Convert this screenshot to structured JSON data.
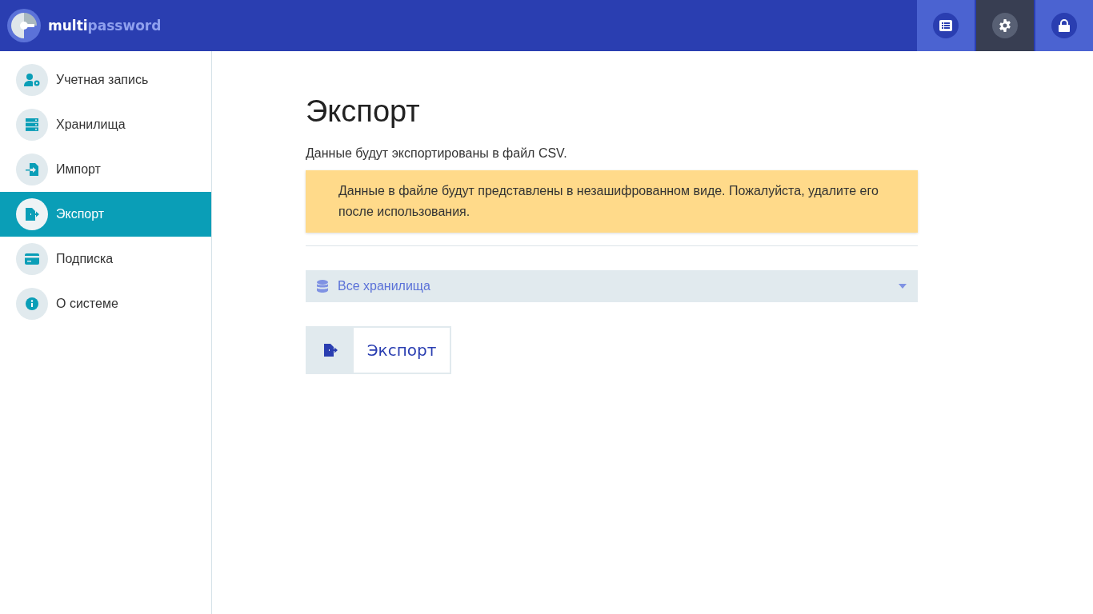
{
  "brand": {
    "name_start": "multi",
    "name_end": "password"
  },
  "header_buttons": [
    {
      "kind": "list",
      "selected": false
    },
    {
      "kind": "settings",
      "selected": true
    },
    {
      "kind": "lock",
      "selected": false
    }
  ],
  "sidebar": {
    "items": [
      {
        "label": "Учетная запись",
        "kind": "account",
        "selected": false
      },
      {
        "label": "Хранилища",
        "kind": "storage",
        "selected": false
      },
      {
        "label": "Импорт",
        "kind": "import",
        "selected": false
      },
      {
        "label": "Экспорт",
        "kind": "export",
        "selected": true
      },
      {
        "label": "Подписка",
        "kind": "card",
        "selected": false
      },
      {
        "label": "О системе",
        "kind": "info",
        "selected": false
      }
    ]
  },
  "content": {
    "title": "Экспорт",
    "description": "Данные будут экспортированы в файл CSV.",
    "warning": "Данные в файле будут представлены в незашифрованном виде. Пожалуйста, удалите его после использования.",
    "vault_select": {
      "value": "Все хранилища"
    },
    "export_button": "Экспорт"
  }
}
